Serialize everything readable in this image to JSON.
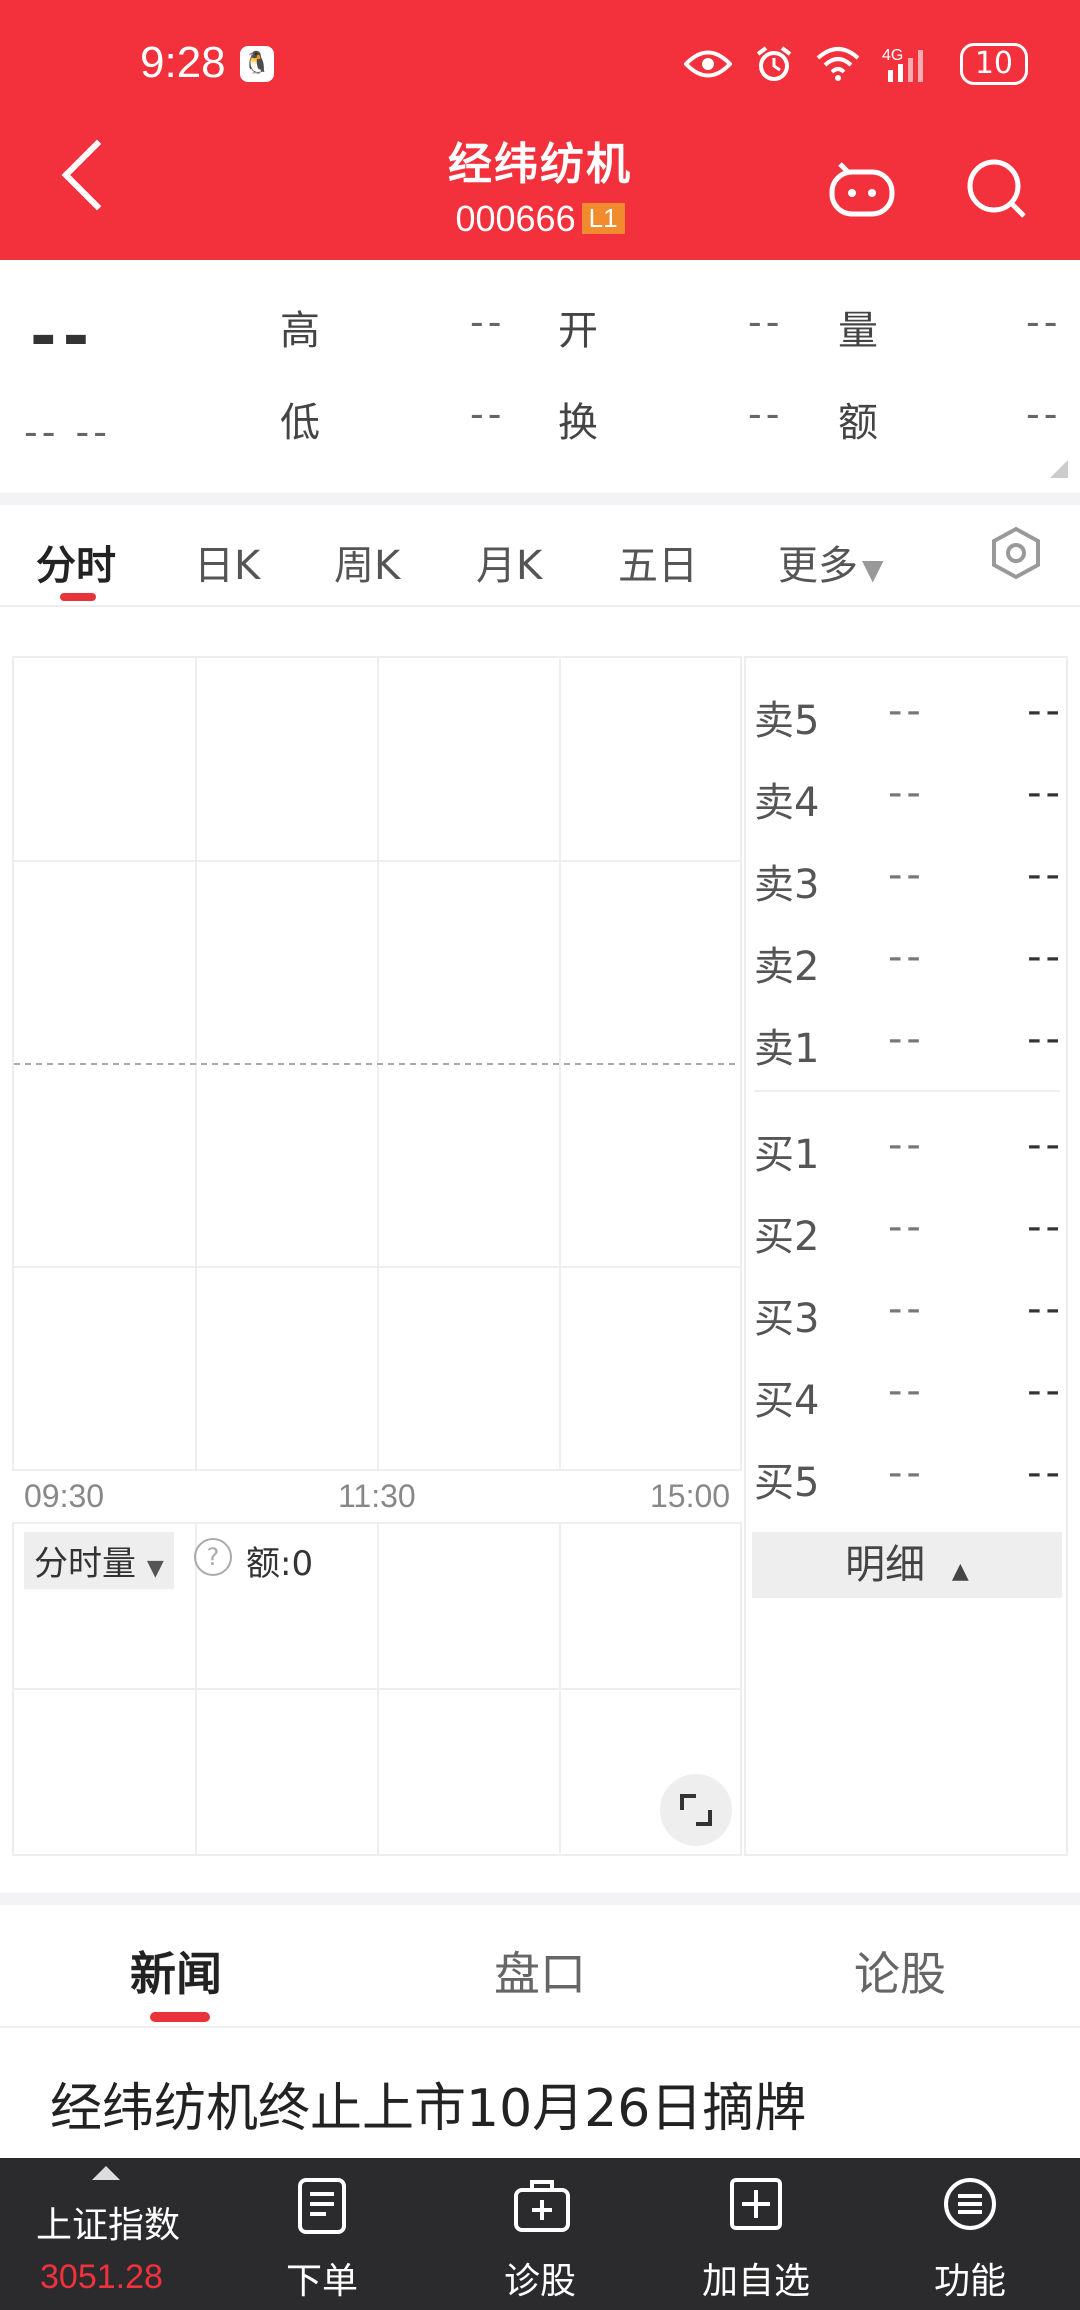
{
  "status_bar": {
    "time": "9:28",
    "battery": "10",
    "network": "4G"
  },
  "header": {
    "title": "经纬纺机",
    "code": "000666",
    "level": "L1"
  },
  "quote": {
    "price": "--",
    "change": "-- --",
    "high_label": "高",
    "high": "--",
    "open_label": "开",
    "open": "--",
    "volume_label": "量",
    "volume": "--",
    "low_label": "低",
    "low": "--",
    "turnover_label": "换",
    "turnover": "--",
    "amount_label": "额",
    "amount": "--"
  },
  "chart_tabs": [
    {
      "label": "分时"
    },
    {
      "label": "日K"
    },
    {
      "label": "周K"
    },
    {
      "label": "月K"
    },
    {
      "label": "五日"
    },
    {
      "label": "更多"
    }
  ],
  "chart": {
    "x_ticks": [
      "09:30",
      "11:30",
      "15:00"
    ],
    "volume_selector": "分时量",
    "volume_amount": "额:0"
  },
  "order_book": {
    "asks": [
      {
        "label": "卖5",
        "price": "--",
        "volume": "--"
      },
      {
        "label": "卖4",
        "price": "--",
        "volume": "--"
      },
      {
        "label": "卖3",
        "price": "--",
        "volume": "--"
      },
      {
        "label": "卖2",
        "price": "--",
        "volume": "--"
      },
      {
        "label": "卖1",
        "price": "--",
        "volume": "--"
      }
    ],
    "bids": [
      {
        "label": "买1",
        "price": "--",
        "volume": "--"
      },
      {
        "label": "买2",
        "price": "--",
        "volume": "--"
      },
      {
        "label": "买3",
        "price": "--",
        "volume": "--"
      },
      {
        "label": "买4",
        "price": "--",
        "volume": "--"
      },
      {
        "label": "买5",
        "price": "--",
        "volume": "--"
      }
    ],
    "detail_label": "明细"
  },
  "news_tabs": [
    {
      "label": "新闻"
    },
    {
      "label": "盘口"
    },
    {
      "label": "论股"
    }
  ],
  "headline": "经纬纺机终止上市10月26日摘牌",
  "bottom_bar": {
    "index_name": "上证指数",
    "index_value": "3051.28",
    "items": [
      {
        "label": "下单"
      },
      {
        "label": "诊股"
      },
      {
        "label": "加自选"
      },
      {
        "label": "功能"
      }
    ]
  },
  "colors": {
    "brand_red": "#f2313d",
    "accent_red": "#e8333b",
    "bottom_bar": "#2b2b2d"
  }
}
